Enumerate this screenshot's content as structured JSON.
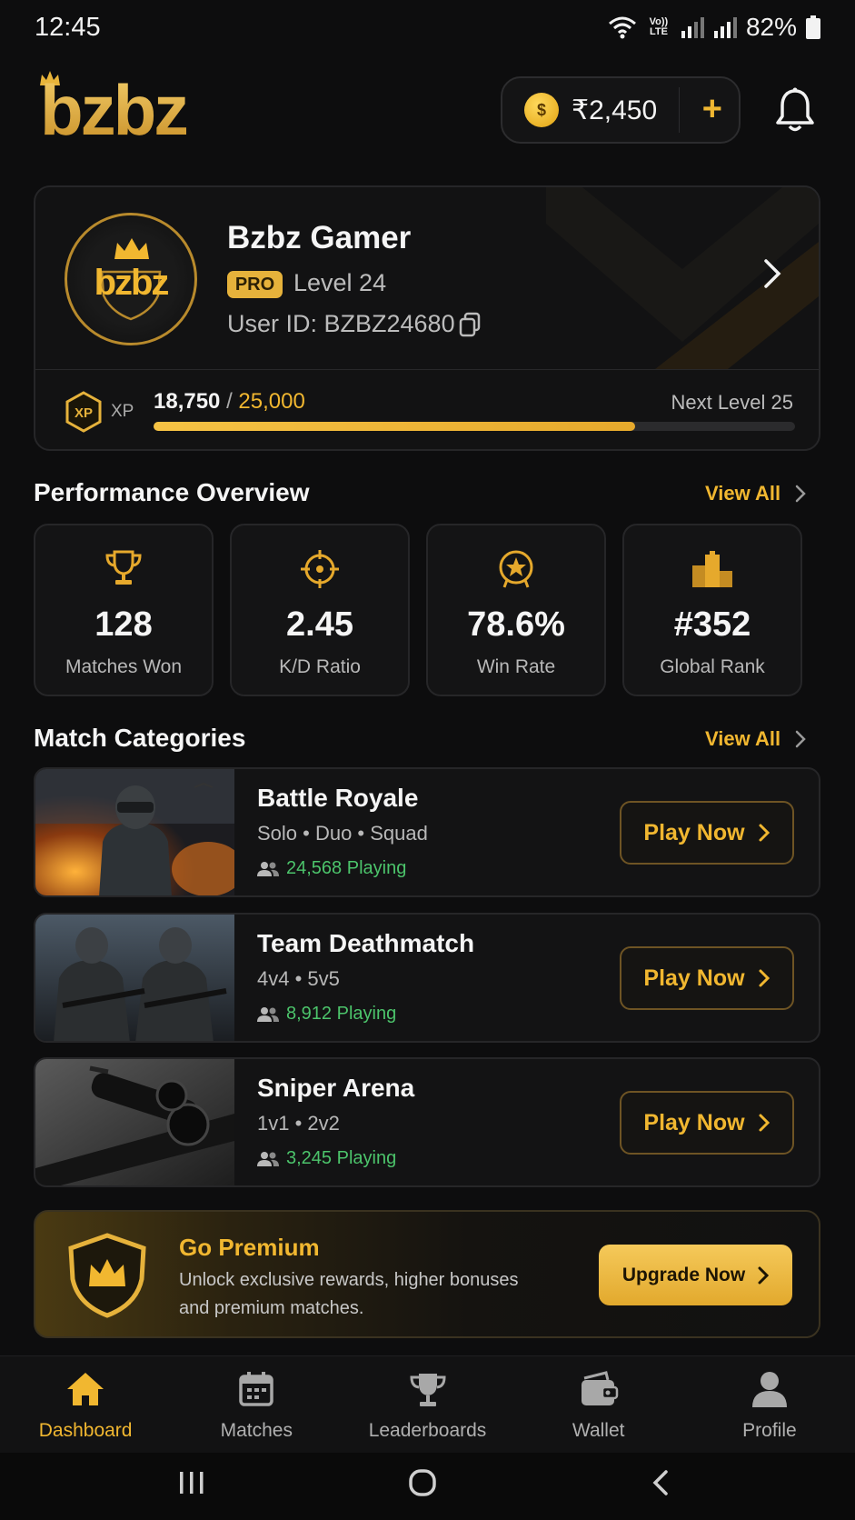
{
  "status_bar": {
    "time": "12:45",
    "network_label": "Vo)) LTE",
    "battery": "82%"
  },
  "header": {
    "logo": "bzbz",
    "balance": "₹2,450",
    "coin_symbol": "$",
    "add_label": "+"
  },
  "profile": {
    "avatar_text": "bzbz",
    "name": "Bzbz Gamer",
    "badge": "PRO",
    "level": "Level 24",
    "user_id": "User ID: BZBZ24680",
    "xp_icon_text": "XP",
    "xp_label": "XP",
    "xp_current": "18,750",
    "xp_separator": " / ",
    "xp_max": "25,000",
    "xp_progress": 0.75,
    "next_level": "Next Level 25"
  },
  "performance": {
    "title": "Performance Overview",
    "view_all": "View All",
    "stats": [
      {
        "value": "128",
        "label": "Matches Won",
        "icon": "trophy-icon"
      },
      {
        "value": "2.45",
        "label": "K/D Ratio",
        "icon": "crosshair-icon"
      },
      {
        "value": "78.6%",
        "label": "Win Rate",
        "icon": "star-badge-icon"
      },
      {
        "value": "#352",
        "label": "Global Rank",
        "icon": "podium-icon"
      }
    ]
  },
  "categories": {
    "title": "Match Categories",
    "view_all": "View All",
    "items": [
      {
        "title": "Battle Royale",
        "modes": "Solo • Duo • Squad",
        "playing": "24,568 Playing",
        "button": "Play Now"
      },
      {
        "title": "Team Deathmatch",
        "modes": "4v4 • 5v5",
        "playing": "8,912 Playing",
        "button": "Play Now"
      },
      {
        "title": "Sniper Arena",
        "modes": "1v1 • 2v2",
        "playing": "3,245 Playing",
        "button": "Play Now"
      }
    ]
  },
  "premium": {
    "title": "Go Premium",
    "description": "Unlock exclusive rewards, higher bonuses and premium matches.",
    "button": "Upgrade Now"
  },
  "bottom_nav": {
    "items": [
      {
        "label": "Dashboard",
        "icon": "home-icon",
        "active": true
      },
      {
        "label": "Matches",
        "icon": "calendar-icon",
        "active": false
      },
      {
        "label": "Leaderboards",
        "icon": "trophy-icon",
        "active": false
      },
      {
        "label": "Wallet",
        "icon": "wallet-icon",
        "active": false
      },
      {
        "label": "Profile",
        "icon": "user-icon",
        "active": false
      }
    ]
  },
  "colors": {
    "accent": "#f1b730",
    "background": "#0d0d0e",
    "card": "#131314",
    "online_green": "#4cc46b"
  }
}
